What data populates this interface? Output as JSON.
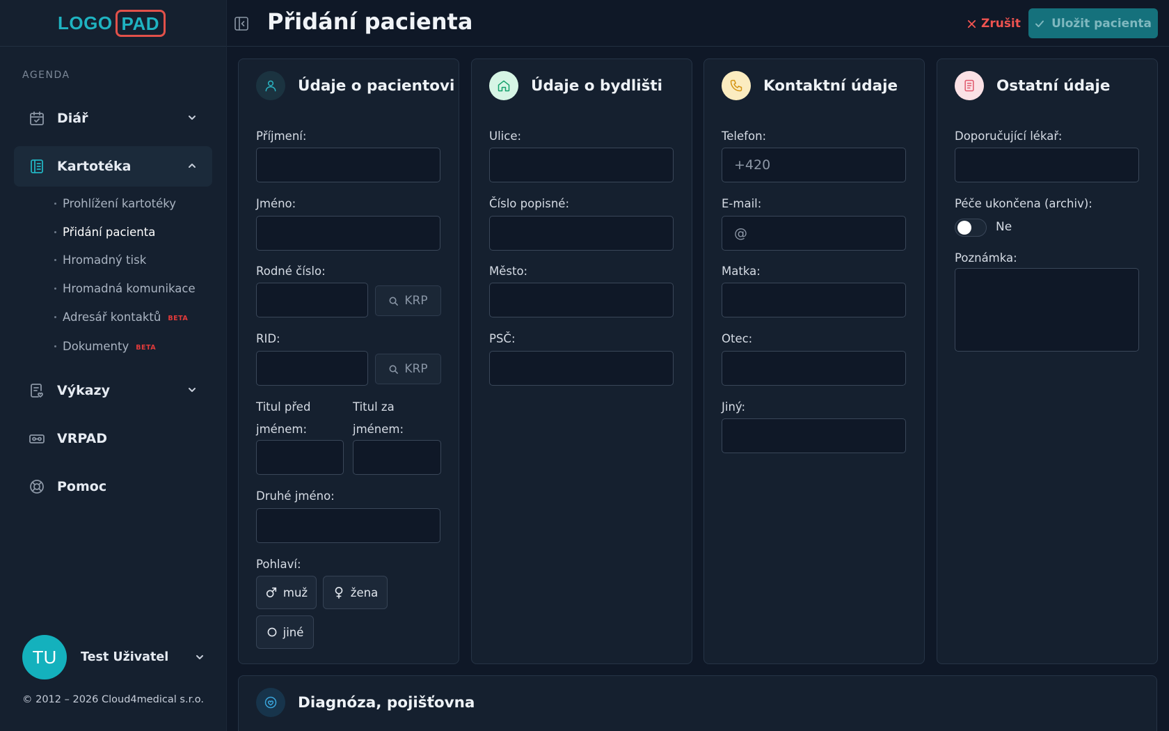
{
  "logo": {
    "part1": "LOGO",
    "part2": "PAD"
  },
  "sidebar": {
    "section_label": "AGENDA",
    "items": [
      {
        "label": "Diář"
      },
      {
        "label": "Kartotéka"
      },
      {
        "label": "Výkazy"
      },
      {
        "label": "VRPAD"
      },
      {
        "label": "Pomoc"
      }
    ],
    "submenu": [
      {
        "label": "Prohlížení kartotéky"
      },
      {
        "label": "Přidání pacienta"
      },
      {
        "label": "Hromadný tisk"
      },
      {
        "label": "Hromadná komunikace"
      },
      {
        "label": "Adresář kontaktů",
        "badge": "BETA"
      },
      {
        "label": "Dokumenty",
        "badge": "BETA"
      }
    ],
    "user": {
      "initials": "TU",
      "name": "Test Uživatel"
    },
    "copyright": "© 2012 – 2026 Cloud4medical s.r.o."
  },
  "header": {
    "title": "Přidání pacienta",
    "cancel_label": "Zrušit",
    "save_label": "Uložit pacienta"
  },
  "colors": {
    "accent": "#14b1bd",
    "danger": "#ef5350",
    "background": "#0f1827",
    "panel": "#15202f"
  },
  "cards": {
    "patient": {
      "title": "Údaje o pacientovi",
      "icon": "user-icon",
      "surname_label": "Příjmení:",
      "name_label": "Jméno:",
      "birth_number_label": "Rodné číslo:",
      "rid_label": "RID:",
      "krp_label": "KRP",
      "title_before_label_1": "Titul před",
      "title_before_label_2": "jménem:",
      "title_after_label_1": "Titul za",
      "title_after_label_2": "jménem:",
      "second_name_label": "Druhé jméno:",
      "gender_label": "Pohlaví:",
      "gender_options": [
        "muž",
        "žena",
        "jiné"
      ]
    },
    "residence": {
      "title": "Údaje o bydlišti",
      "icon": "home-icon",
      "street_label": "Ulice:",
      "number_label": "Číslo popisné:",
      "city_label": "Město:",
      "zip_label": "PSČ:"
    },
    "contact": {
      "title": "Kontaktní údaje",
      "icon": "phone-icon",
      "phone_label": "Telefon:",
      "phone_placeholder": "+420",
      "email_label": "E-mail:",
      "email_placeholder": "@",
      "mother_label": "Matka:",
      "father_label": "Otec:",
      "other_label": "Jiný:"
    },
    "other": {
      "title": "Ostatní údaje",
      "icon": "document-icon",
      "referring_label": "Doporučující lékař:",
      "archive_label": "Péče ukončena (archiv):",
      "archive_value": "Ne",
      "note_label": "Poznámka:"
    },
    "diagnosis": {
      "title": "Diagnóza, pojišťovna",
      "icon": "heart-shield-icon"
    }
  }
}
